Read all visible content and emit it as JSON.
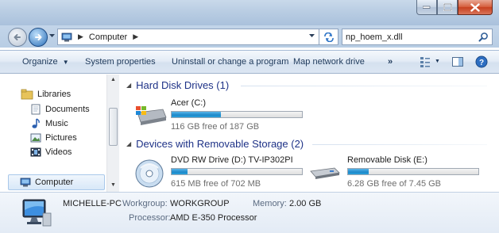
{
  "address": {
    "crumbs": [
      "Computer"
    ],
    "search_value": "np_hoem_x.dll"
  },
  "toolbar": {
    "organize": "Organize",
    "system_properties": "System properties",
    "uninstall": "Uninstall or change a program",
    "map_drive": "Map network drive",
    "more": "»"
  },
  "sidebar": {
    "libraries": "Libraries",
    "documents": "Documents",
    "music": "Music",
    "pictures": "Pictures",
    "videos": "Videos",
    "computer": "Computer"
  },
  "groups": {
    "hdd": "Hard Disk Drives (1)",
    "removable": "Devices with Removable Storage (2)"
  },
  "drives": {
    "c": {
      "name": "Acer (C:)",
      "free": "116 GB free of 187 GB",
      "used_fraction": 0.38
    },
    "d": {
      "name": "DVD RW Drive (D:) TV-IP302PI",
      "free": "615 MB free of 702 MB",
      "used_fraction": 0.12
    },
    "e": {
      "name": "Removable Disk (E:)",
      "free": "6.28 GB free of 7.45 GB",
      "used_fraction": 0.16
    }
  },
  "details": {
    "pc_name": "MICHELLE-PC",
    "workgroup_label": "Workgroup:",
    "workgroup_value": "WORKGROUP",
    "memory_label": "Memory:",
    "memory_value": "2.00 GB",
    "processor_label": "Processor:",
    "processor_value": "AMD E-350 Processor"
  },
  "colors": {
    "accent": "#1e88c9",
    "group_header": "#1e3287",
    "close_button": "#c7401f"
  }
}
